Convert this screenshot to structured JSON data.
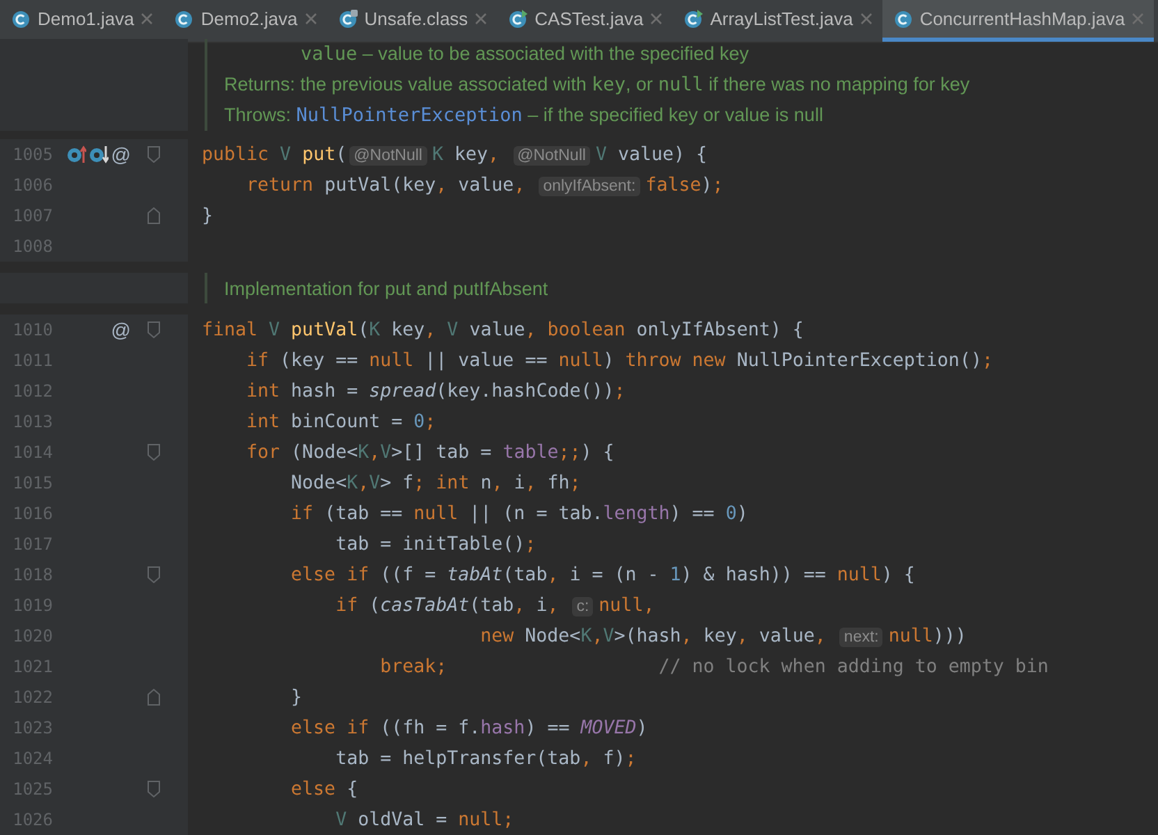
{
  "tabs": [
    {
      "label": "Demo1.java",
      "kind": "class",
      "selected": false
    },
    {
      "label": "Demo2.java",
      "kind": "class",
      "selected": false
    },
    {
      "label": "Unsafe.class",
      "kind": "compiled",
      "selected": false
    },
    {
      "label": "CASTest.java",
      "kind": "runnable",
      "selected": false
    },
    {
      "label": "ArrayListTest.java",
      "kind": "runnable",
      "selected": false
    },
    {
      "label": "ConcurrentHashMap.java",
      "kind": "class",
      "selected": true
    }
  ],
  "rows": [
    {
      "kind": "doc",
      "lines": [
        {
          "kind": "param",
          "segments": [
            {
              "kind": "code",
              "text": "value"
            },
            {
              "kind": "text",
              "text": " – value to be associated with the specified key"
            }
          ]
        },
        {
          "kind": "returns",
          "segments": [
            {
              "kind": "label",
              "text": "Returns: "
            },
            {
              "kind": "text",
              "text": "the previous value associated with "
            },
            {
              "kind": "code",
              "text": "key"
            },
            {
              "kind": "text",
              "text": ", or "
            },
            {
              "kind": "code",
              "text": "null"
            },
            {
              "kind": "text",
              "text": " if there was no mapping for key"
            }
          ]
        },
        {
          "kind": "throws",
          "segments": [
            {
              "kind": "label",
              "text": "Throws: "
            },
            {
              "kind": "link",
              "text": "NullPointerException"
            },
            {
              "kind": "text",
              "text": " – if the specified key or value is null"
            }
          ]
        }
      ]
    },
    {
      "kind": "code",
      "number": "1005",
      "gutter": [
        {
          "kind": "overrides"
        },
        {
          "kind": "implemented"
        },
        {
          "kind": "annotation",
          "text": "@"
        }
      ],
      "fold_start": true,
      "tokens": [
        {
          "kind": "kw",
          "text": "public"
        },
        {
          "kind": "tparam",
          "text": " V"
        },
        {
          "kind": "decl",
          "text": " put"
        },
        {
          "kind": "plain",
          "text": "("
        },
        {
          "kind": "hint",
          "text": "@NotNull"
        },
        {
          "kind": "tparam",
          "text": "K"
        },
        {
          "kind": "plain",
          "text": " key"
        },
        {
          "kind": "punct",
          "text": ", "
        },
        {
          "kind": "hint",
          "text": "@NotNull"
        },
        {
          "kind": "tparam",
          "text": "V"
        },
        {
          "kind": "plain",
          "text": " value) {"
        }
      ]
    },
    {
      "kind": "code",
      "number": "1006",
      "tokens": [
        {
          "kind": "kw",
          "text": "    return"
        },
        {
          "kind": "plain",
          "text": " putVal(key"
        },
        {
          "kind": "punct",
          "text": ","
        },
        {
          "kind": "plain",
          "text": " value"
        },
        {
          "kind": "punct",
          "text": ", "
        },
        {
          "kind": "hint",
          "text": "onlyIfAbsent:"
        },
        {
          "kind": "kw",
          "text": "false"
        },
        {
          "kind": "plain",
          "text": ")"
        },
        {
          "kind": "punct",
          "text": ";"
        }
      ]
    },
    {
      "kind": "code",
      "number": "1007",
      "fold_end": true,
      "tokens": [
        {
          "kind": "plain",
          "text": "}"
        }
      ]
    },
    {
      "kind": "code",
      "number": "1008"
    },
    {
      "kind": "doc",
      "lines": [
        {
          "kind": "text",
          "segments": [
            {
              "kind": "text",
              "text": "Implementation for put and putIfAbsent"
            }
          ]
        }
      ]
    },
    {
      "kind": "code",
      "number": "1010",
      "gutter": [
        {
          "kind": "annotation",
          "text": "@"
        }
      ],
      "fold_start": true,
      "tokens": [
        {
          "kind": "kw",
          "text": "final"
        },
        {
          "kind": "tparam",
          "text": " V"
        },
        {
          "kind": "decl",
          "text": " putVal"
        },
        {
          "kind": "plain",
          "text": "("
        },
        {
          "kind": "tparam",
          "text": "K"
        },
        {
          "kind": "plain",
          "text": " key"
        },
        {
          "kind": "punct",
          "text": ","
        },
        {
          "kind": "tparam",
          "text": " V"
        },
        {
          "kind": "plain",
          "text": " value"
        },
        {
          "kind": "punct",
          "text": ","
        },
        {
          "kind": "kw",
          "text": " boolean"
        },
        {
          "kind": "plain",
          "text": " onlyIfAbsent) {"
        }
      ]
    },
    {
      "kind": "code",
      "number": "1011",
      "tokens": [
        {
          "kind": "kw",
          "text": "    if"
        },
        {
          "kind": "plain",
          "text": " (key == "
        },
        {
          "kind": "kw",
          "text": "null"
        },
        {
          "kind": "plain",
          "text": " || value == "
        },
        {
          "kind": "kw",
          "text": "null"
        },
        {
          "kind": "plain",
          "text": ") "
        },
        {
          "kind": "kw",
          "text": "throw new"
        },
        {
          "kind": "plain",
          "text": " NullPointerException()"
        },
        {
          "kind": "punct",
          "text": ";"
        }
      ]
    },
    {
      "kind": "code",
      "number": "1012",
      "tokens": [
        {
          "kind": "kw",
          "text": "    int"
        },
        {
          "kind": "plain",
          "text": " hash = "
        },
        {
          "kind": "static",
          "text": "spread"
        },
        {
          "kind": "plain",
          "text": "(key.hashCode())"
        },
        {
          "kind": "punct",
          "text": ";"
        }
      ]
    },
    {
      "kind": "code",
      "number": "1013",
      "tokens": [
        {
          "kind": "kw",
          "text": "    int"
        },
        {
          "kind": "plain",
          "text": " binCount = "
        },
        {
          "kind": "num",
          "text": "0"
        },
        {
          "kind": "punct",
          "text": ";"
        }
      ]
    },
    {
      "kind": "code",
      "number": "1014",
      "fold_start": true,
      "tokens": [
        {
          "kind": "kw",
          "text": "    for"
        },
        {
          "kind": "plain",
          "text": " (Node<"
        },
        {
          "kind": "tparam",
          "text": "K"
        },
        {
          "kind": "punct",
          "text": ","
        },
        {
          "kind": "tparam",
          "text": "V"
        },
        {
          "kind": "plain",
          "text": ">[] tab = "
        },
        {
          "kind": "field",
          "text": "table"
        },
        {
          "kind": "punct",
          "text": ";;"
        },
        {
          "kind": "plain",
          "text": ") {"
        }
      ]
    },
    {
      "kind": "code",
      "number": "1015",
      "tokens": [
        {
          "kind": "plain",
          "text": "        Node<"
        },
        {
          "kind": "tparam",
          "text": "K"
        },
        {
          "kind": "punct",
          "text": ","
        },
        {
          "kind": "tparam",
          "text": "V"
        },
        {
          "kind": "plain",
          "text": "> f"
        },
        {
          "kind": "punct",
          "text": ";"
        },
        {
          "kind": "kw",
          "text": " int"
        },
        {
          "kind": "plain",
          "text": " n"
        },
        {
          "kind": "punct",
          "text": ","
        },
        {
          "kind": "plain",
          "text": " i"
        },
        {
          "kind": "punct",
          "text": ","
        },
        {
          "kind": "plain",
          "text": " fh"
        },
        {
          "kind": "punct",
          "text": ";"
        }
      ]
    },
    {
      "kind": "code",
      "number": "1016",
      "tokens": [
        {
          "kind": "kw",
          "text": "        if"
        },
        {
          "kind": "plain",
          "text": " (tab == "
        },
        {
          "kind": "kw",
          "text": "null"
        },
        {
          "kind": "plain",
          "text": " || (n = tab."
        },
        {
          "kind": "field",
          "text": "length"
        },
        {
          "kind": "plain",
          "text": ") == "
        },
        {
          "kind": "num",
          "text": "0"
        },
        {
          "kind": "plain",
          "text": ")"
        }
      ]
    },
    {
      "kind": "code",
      "number": "1017",
      "tokens": [
        {
          "kind": "plain",
          "text": "            tab = initTable()"
        },
        {
          "kind": "punct",
          "text": ";"
        }
      ]
    },
    {
      "kind": "code",
      "number": "1018",
      "fold_start": true,
      "tokens": [
        {
          "kind": "kw",
          "text": "        else if"
        },
        {
          "kind": "plain",
          "text": " ((f = "
        },
        {
          "kind": "static",
          "text": "tabAt"
        },
        {
          "kind": "plain",
          "text": "(tab"
        },
        {
          "kind": "punct",
          "text": ","
        },
        {
          "kind": "plain",
          "text": " i = (n - "
        },
        {
          "kind": "num",
          "text": "1"
        },
        {
          "kind": "plain",
          "text": ") & hash)) == "
        },
        {
          "kind": "kw",
          "text": "null"
        },
        {
          "kind": "plain",
          "text": ") {"
        }
      ]
    },
    {
      "kind": "code",
      "number": "1019",
      "tokens": [
        {
          "kind": "kw",
          "text": "            if"
        },
        {
          "kind": "plain",
          "text": " ("
        },
        {
          "kind": "static",
          "text": "casTabAt"
        },
        {
          "kind": "plain",
          "text": "(tab"
        },
        {
          "kind": "punct",
          "text": ","
        },
        {
          "kind": "plain",
          "text": " i"
        },
        {
          "kind": "punct",
          "text": ", "
        },
        {
          "kind": "hint",
          "text": "c:"
        },
        {
          "kind": "kw",
          "text": "null"
        },
        {
          "kind": "punct",
          "text": ","
        }
      ]
    },
    {
      "kind": "code",
      "number": "1020",
      "tokens": [
        {
          "kind": "kw",
          "text": "                         new"
        },
        {
          "kind": "plain",
          "text": " Node<"
        },
        {
          "kind": "tparam",
          "text": "K"
        },
        {
          "kind": "punct",
          "text": ","
        },
        {
          "kind": "tparam",
          "text": "V"
        },
        {
          "kind": "plain",
          "text": ">(hash"
        },
        {
          "kind": "punct",
          "text": ","
        },
        {
          "kind": "plain",
          "text": " key"
        },
        {
          "kind": "punct",
          "text": ","
        },
        {
          "kind": "plain",
          "text": " value"
        },
        {
          "kind": "punct",
          "text": ", "
        },
        {
          "kind": "hint",
          "text": "next:"
        },
        {
          "kind": "kw",
          "text": "null"
        },
        {
          "kind": "plain",
          "text": ")))"
        }
      ]
    },
    {
      "kind": "code",
      "number": "1021",
      "tokens": [
        {
          "kind": "kw",
          "text": "                break"
        },
        {
          "kind": "punct",
          "text": ";"
        },
        {
          "kind": "comment",
          "text": "                   // no lock when adding to empty bin"
        }
      ]
    },
    {
      "kind": "code",
      "number": "1022",
      "fold_end": true,
      "tokens": [
        {
          "kind": "plain",
          "text": "        }"
        }
      ]
    },
    {
      "kind": "code",
      "number": "1023",
      "tokens": [
        {
          "kind": "kw",
          "text": "        else if"
        },
        {
          "kind": "plain",
          "text": " ((fh = f."
        },
        {
          "kind": "field",
          "text": "hash"
        },
        {
          "kind": "plain",
          "text": ") == "
        },
        {
          "kind": "const",
          "text": "MOVED"
        },
        {
          "kind": "plain",
          "text": ")"
        }
      ]
    },
    {
      "kind": "code",
      "number": "1024",
      "tokens": [
        {
          "kind": "plain",
          "text": "            tab = helpTransfer(tab"
        },
        {
          "kind": "punct",
          "text": ","
        },
        {
          "kind": "plain",
          "text": " f)"
        },
        {
          "kind": "punct",
          "text": ";"
        }
      ]
    },
    {
      "kind": "code",
      "number": "1025",
      "fold_start": true,
      "tokens": [
        {
          "kind": "kw",
          "text": "        else"
        },
        {
          "kind": "plain",
          "text": " {"
        }
      ]
    },
    {
      "kind": "code",
      "number": "1026",
      "tokens": [
        {
          "kind": "tparam",
          "text": "            V"
        },
        {
          "kind": "plain",
          "text": " oldVal = "
        },
        {
          "kind": "kw",
          "text": "null"
        },
        {
          "kind": "punct",
          "text": ";"
        }
      ]
    }
  ]
}
